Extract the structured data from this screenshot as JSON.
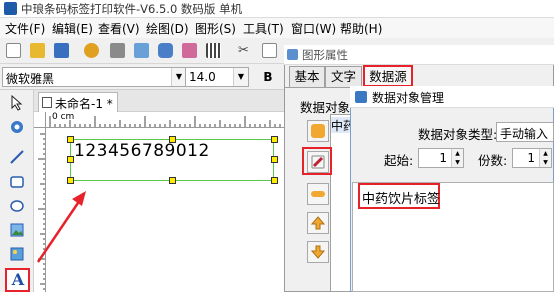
{
  "window": {
    "title": "中琅条码标签打印软件-V6.5.0 数码版 单机"
  },
  "menu": [
    "文件(F)",
    "编辑(E)",
    "查看(V)",
    "绘图(D)",
    "图形(S)",
    "工具(T)",
    "窗口(W)",
    "帮助(H)"
  ],
  "fontbar": {
    "font_name": "微软雅黑",
    "font_size": "14.0",
    "bold_label": "B"
  },
  "document": {
    "tab_label": "未命名-1 *",
    "ruler_origin": "0 cm",
    "barcode_text": "123456789012"
  },
  "props_dialog": {
    "title": "图形属性",
    "tabs": [
      "基本",
      "文字",
      "数据源"
    ],
    "active_tab": "数据源",
    "data_object_label": "数据对象",
    "list_item": "中药"
  },
  "data_object_dialog": {
    "title": "数据对象管理",
    "type_label": "数据对象类型:",
    "type_value": "手动输入",
    "start_label": "起始:",
    "start_value": "1",
    "copies_label": "份数:",
    "copies_value": "1",
    "content": "中药饮片标签"
  },
  "colors": {
    "highlight_red": "#e8222a",
    "selection_green": "#59c84a",
    "handle_yellow": "#ffeb00"
  }
}
